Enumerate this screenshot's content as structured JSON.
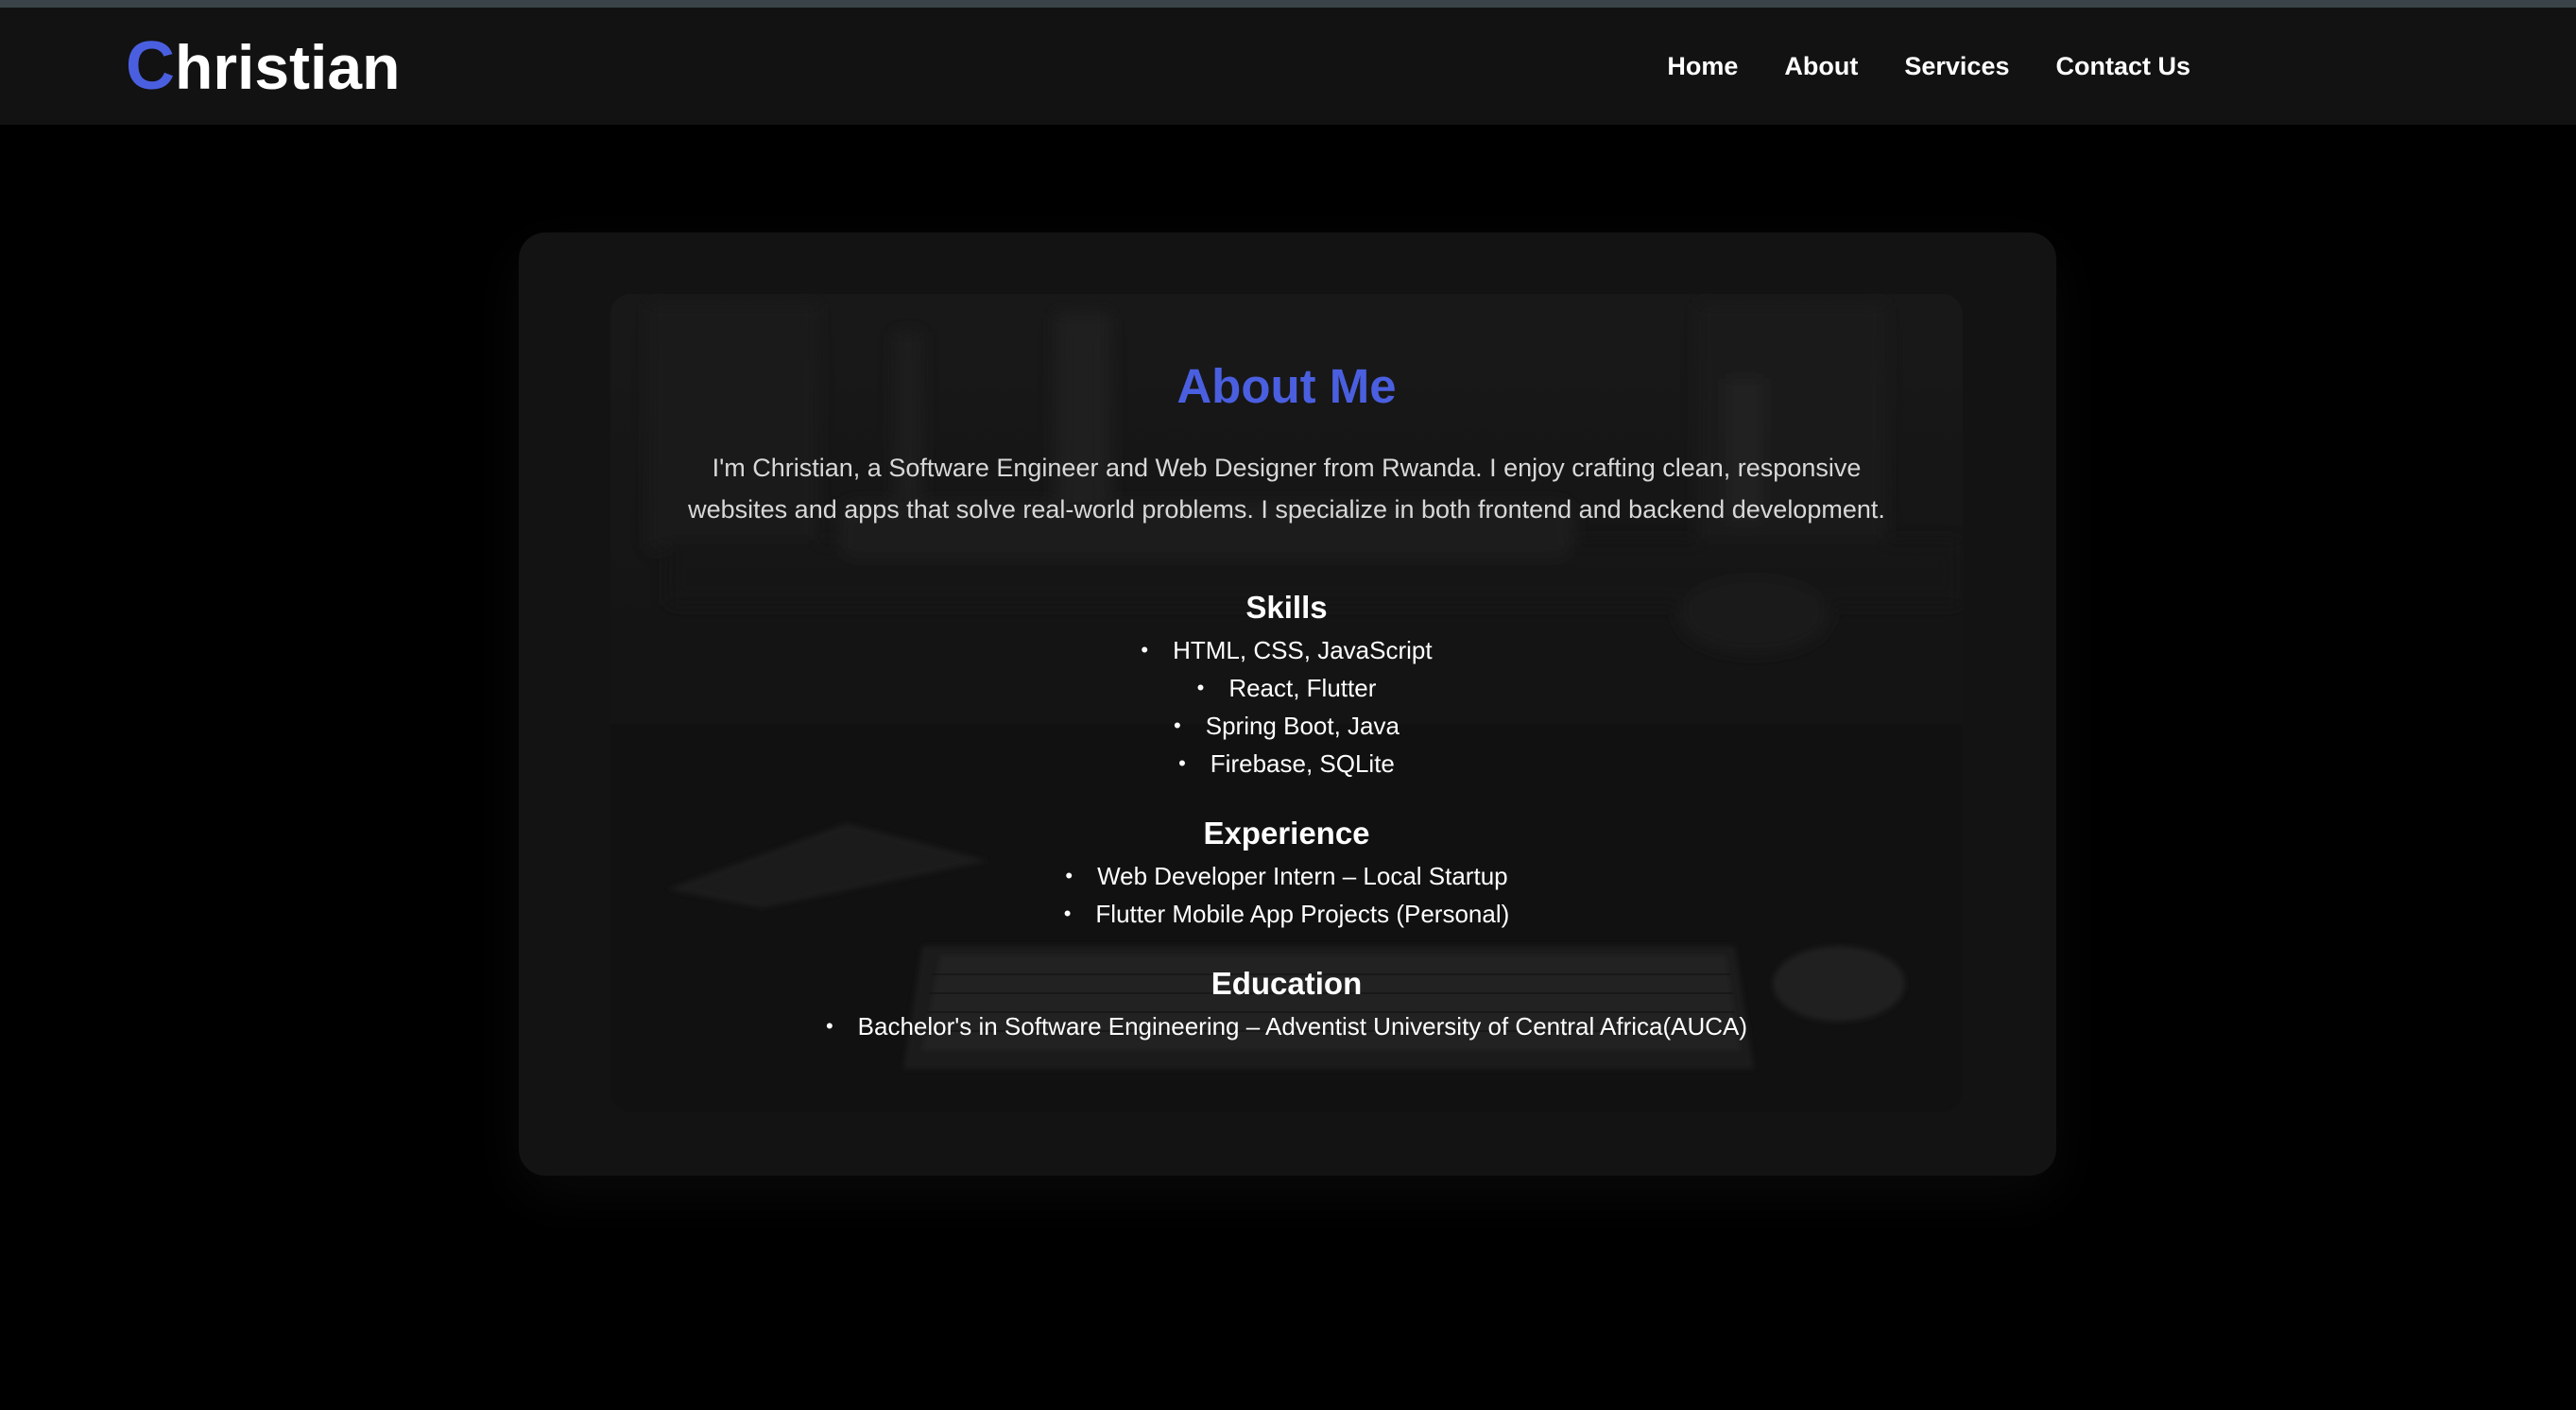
{
  "header": {
    "logo_first_letter": "C",
    "logo_rest": "hristian",
    "nav": [
      {
        "label": "Home"
      },
      {
        "label": "About"
      },
      {
        "label": "Services"
      },
      {
        "label": "Contact Us"
      }
    ]
  },
  "about": {
    "title": "About Me",
    "intro": "I'm Christian, a Software Engineer and Web Designer from Rwanda. I enjoy crafting clean, responsive websites and apps that solve real-world problems. I specialize in both frontend and backend development.",
    "skills": {
      "heading": "Skills",
      "items": [
        "HTML, CSS, JavaScript",
        "React, Flutter",
        "Spring Boot, Java",
        "Firebase, SQLite"
      ]
    },
    "experience": {
      "heading": "Experience",
      "items": [
        "Web Developer Intern – Local Startup",
        "Flutter Mobile App Projects (Personal)"
      ]
    },
    "education": {
      "heading": "Education",
      "items": [
        "Bachelor's in Software Engineering – Adventist University of Central Africa(AUCA)"
      ]
    }
  },
  "colors": {
    "accent": "#4a5fe0",
    "navbar_bg": "#121212",
    "page_bg": "#000000"
  }
}
